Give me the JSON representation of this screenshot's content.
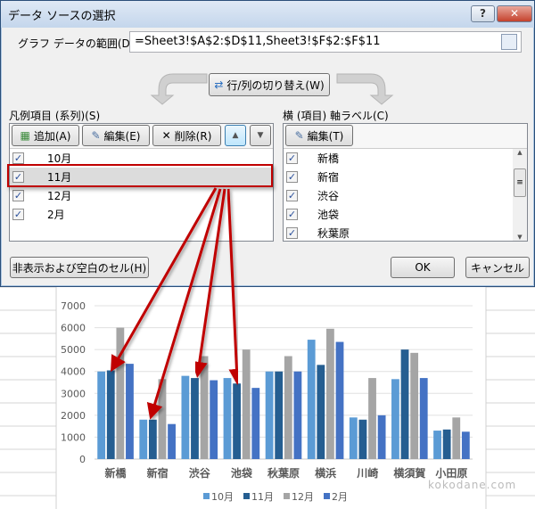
{
  "dialog": {
    "title": "データ ソースの選択",
    "help_label": "?",
    "close_label": "✕",
    "range_label": "グラフ データの範囲(D):",
    "range_value": "=Sheet3!$A$2:$D$11,Sheet3!$F$2:$F$11",
    "switch_label": "行/列の切り替え(W)",
    "series_label": "凡例項目 (系列)(S)",
    "add_label": "追加(A)",
    "edit_label": "編集(E)",
    "delete_label": "削除(R)",
    "up_label": "▲",
    "down_label": "▼",
    "series": [
      {
        "label": "10月",
        "checked": true
      },
      {
        "label": "11月",
        "checked": true,
        "selected": true
      },
      {
        "label": "12月",
        "checked": true
      },
      {
        "label": "2月",
        "checked": true
      }
    ],
    "axis_label": "横 (項目) 軸ラベル(C)",
    "axis_edit_label": "編集(T)",
    "categories": [
      {
        "label": "新橋",
        "checked": true
      },
      {
        "label": "新宿",
        "checked": true
      },
      {
        "label": "渋谷",
        "checked": true
      },
      {
        "label": "池袋",
        "checked": true
      },
      {
        "label": "秋葉原",
        "checked": true
      }
    ],
    "hidden_cells_label": "非表示および空白のセル(H)",
    "ok_label": "OK",
    "cancel_label": "キャンセル"
  },
  "watermark": "kokodane.com",
  "chart_data": {
    "type": "bar",
    "categories": [
      "新橋",
      "新宿",
      "渋谷",
      "池袋",
      "秋葉原",
      "横浜",
      "川崎",
      "横須賀",
      "小田原"
    ],
    "series": [
      {
        "name": "10月",
        "color": "#5b9bd5",
        "values": [
          4000,
          1800,
          3800,
          3700,
          4000,
          5450,
          1900,
          3650,
          1300
        ]
      },
      {
        "name": "11月",
        "color": "#255e91",
        "values": [
          4050,
          1800,
          3700,
          3450,
          4000,
          4300,
          1800,
          5000,
          1350
        ]
      },
      {
        "name": "12月",
        "color": "#a5a5a5",
        "values": [
          6000,
          3650,
          4700,
          5000,
          4700,
          5950,
          3700,
          4850,
          1900
        ]
      },
      {
        "name": "2月",
        "color": "#4472c4",
        "values": [
          4350,
          1600,
          3600,
          3250,
          4000,
          5350,
          2000,
          3700,
          1250
        ]
      }
    ],
    "yticks": [
      0,
      1000,
      2000,
      3000,
      4000,
      5000,
      6000,
      7000
    ],
    "ylim": [
      0,
      7000
    ],
    "grid": true,
    "legend": "bottom"
  },
  "annotation_color": "#c00000"
}
